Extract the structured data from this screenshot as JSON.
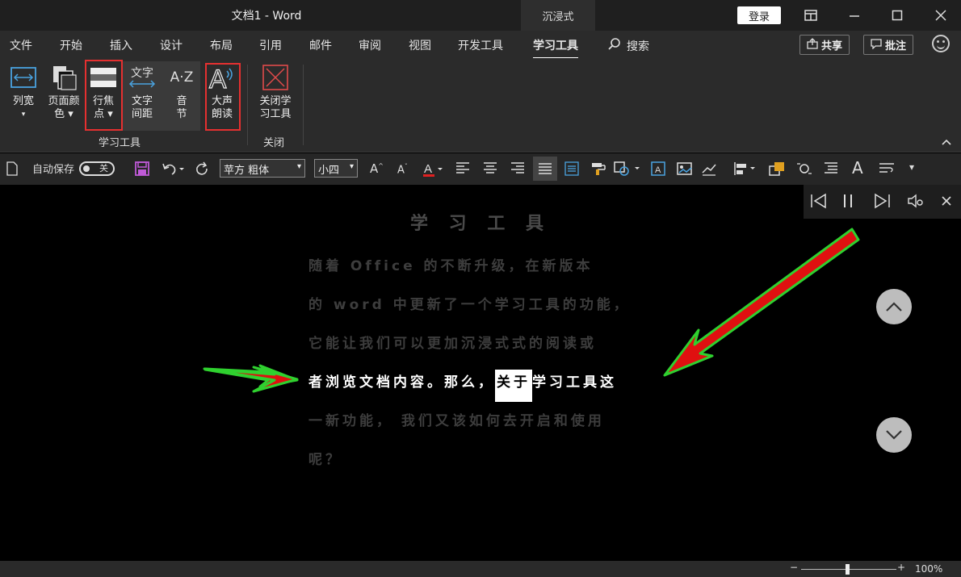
{
  "titlebar": {
    "title": "文档1  -  Word",
    "immersive_tab": "沉浸式",
    "login": "登录",
    "icons": [
      "ribbon-display-icon",
      "minimize-icon",
      "maximize-icon",
      "close-icon"
    ]
  },
  "tabs": [
    {
      "label": "文件"
    },
    {
      "label": "开始"
    },
    {
      "label": "插入"
    },
    {
      "label": "设计"
    },
    {
      "label": "布局"
    },
    {
      "label": "引用"
    },
    {
      "label": "邮件"
    },
    {
      "label": "审阅"
    },
    {
      "label": "视图"
    },
    {
      "label": "开发工具"
    },
    {
      "label": "学习工具"
    }
  ],
  "search": {
    "label": "搜索"
  },
  "share": {
    "label": "共享"
  },
  "comment": {
    "label": "批注"
  },
  "ribbon": {
    "column_width": {
      "line1": "列宽",
      "line2": "▾"
    },
    "page_color": {
      "line1": "页面颜",
      "line2": "色 ▾"
    },
    "line_focus": {
      "line1": "行焦",
      "line2": "点 ▾"
    },
    "text_spacing": {
      "icon_text": "文字",
      "line1": "文字",
      "line2": "间距"
    },
    "syllables": {
      "icon_text": "A·Z",
      "line1": "音",
      "line2": "节"
    },
    "read_aloud": {
      "line1": "大声",
      "line2": "朗读"
    },
    "close_tools": {
      "line1": "关闭学",
      "line2": "习工具"
    },
    "group_learning": "学习工具",
    "group_close": "关闭"
  },
  "qat": {
    "autosave": "自动保存",
    "autosave_state": "关",
    "font_name": "苹方 粗体",
    "font_size": "小四"
  },
  "document": {
    "title": "学 习 工 具",
    "lines": [
      "    随着 Office 的不断升级，在新版本",
      "的 word 中更新了一个学习工具的功能，",
      "它能让我们可以更加沉浸式式的阅读或",
      "一新功能， 我们又该如何去开启和使用",
      "呢？"
    ],
    "focus_before": "者浏览文档内容。那么，",
    "focus_word": "关于",
    "focus_after": "学习工具这"
  },
  "status": {
    "zoom": "100%"
  },
  "colors": {
    "highlight_box": "#e53030",
    "arrow_fill": "#e01010",
    "arrow_outline": "#2fd12f"
  }
}
